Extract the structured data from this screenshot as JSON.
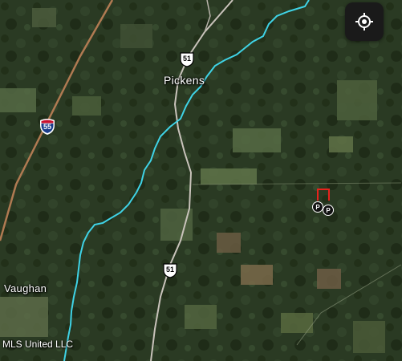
{
  "map": {
    "view": "satellite",
    "colors": {
      "river": "#3fd3e6",
      "highway": "#c9c3bb",
      "interstate_road": "#b07a52",
      "parcel_outline": "#e8221c"
    }
  },
  "places": {
    "pickens": "Pickens",
    "vaughan": "Vaughan"
  },
  "shields": {
    "interstate": {
      "number": "55",
      "type": "interstate-shield"
    },
    "us_north": {
      "number": "51",
      "type": "us-route-shield"
    },
    "us_south": {
      "number": "51",
      "type": "us-route-shield"
    }
  },
  "attribution": "MLS United LLC",
  "controls": {
    "locate_icon": "crosshair-locate-icon"
  },
  "markers": [
    {
      "label": "P",
      "icon": "listing-pin"
    },
    {
      "label": "P",
      "icon": "listing-pin"
    }
  ]
}
